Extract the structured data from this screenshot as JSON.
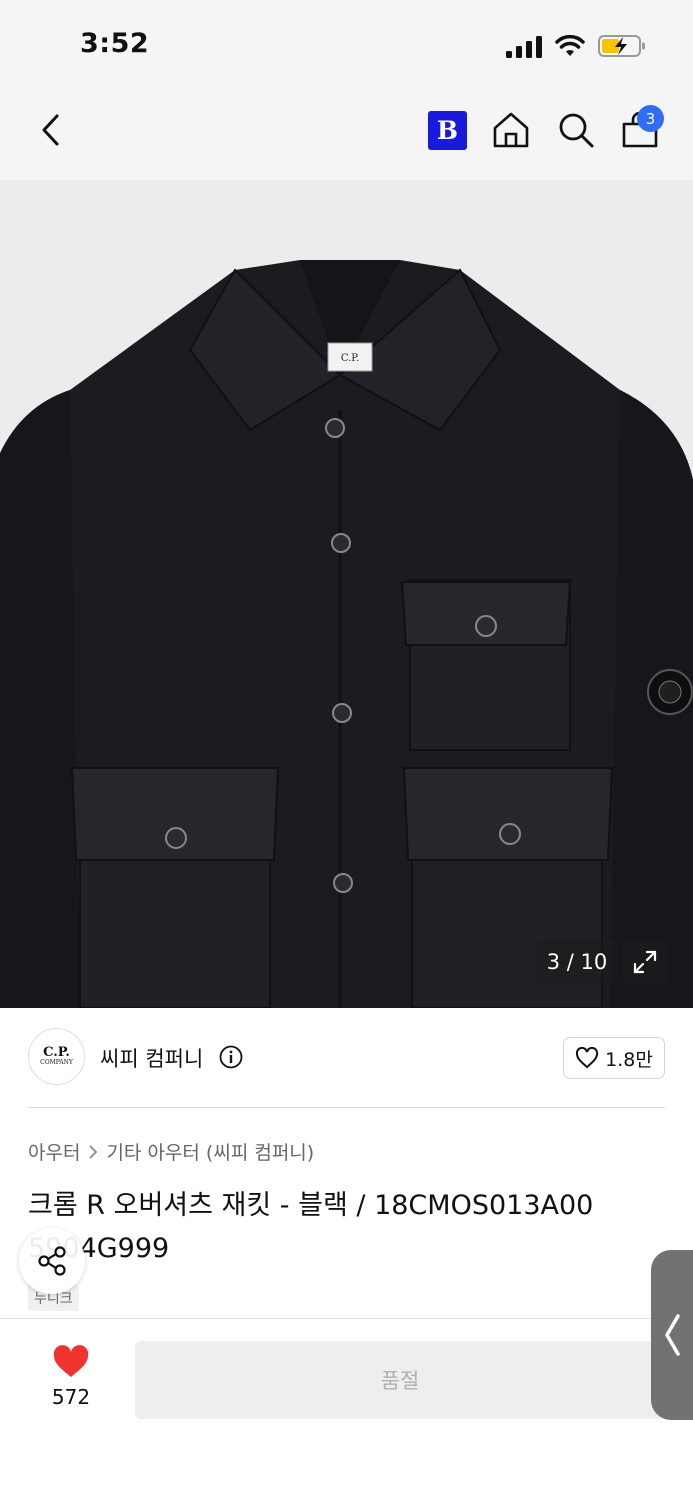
{
  "status_bar": {
    "time": "3:52"
  },
  "nav": {
    "brand_button_label": "B",
    "cart_count": "3"
  },
  "image": {
    "counter": "3 / 10"
  },
  "brand": {
    "logo_text_top": "C.P.",
    "logo_text_bottom": "COMPANY",
    "name": "씨피 컴퍼니",
    "like_count": "1.8만"
  },
  "breadcrumb": {
    "level1": "아우터",
    "level2": "기타 아우터 (씨피 컴퍼니)"
  },
  "product": {
    "title": "크롬 R 오버셔츠 재킷 - 블랙 / 18CMOS013A00 5904G999",
    "tag": "누니크"
  },
  "bottom": {
    "wish_count": "572",
    "soldout_label": "품절"
  },
  "colors": {
    "brand_blue": "#1a1adb",
    "badge_blue": "#2f6df5",
    "heart_red": "#f0332c"
  }
}
